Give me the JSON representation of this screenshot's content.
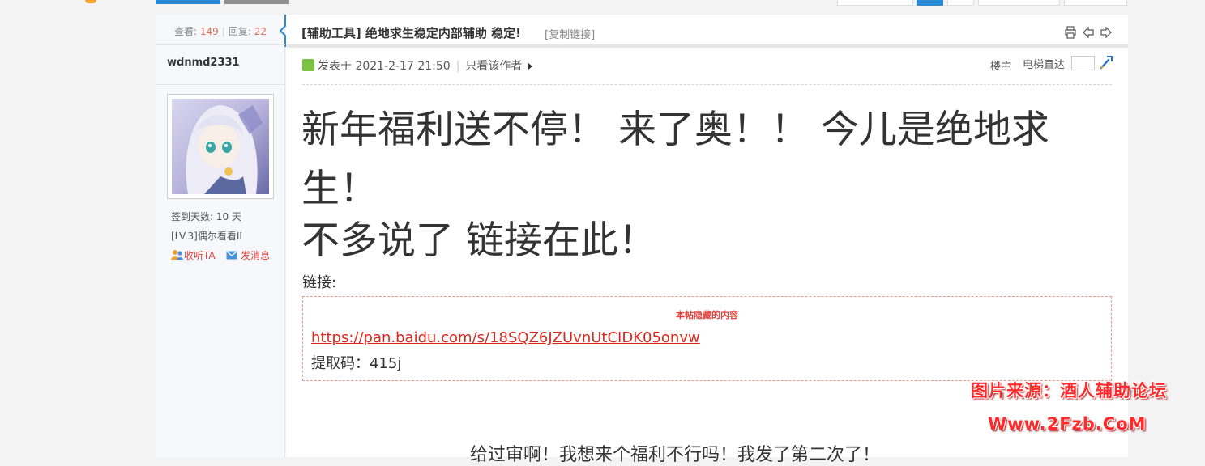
{
  "thread": {
    "title": "[辅助工具] 绝地求生稳定内部辅助 稳定!",
    "copy_link": "[复制链接]",
    "views_label": "查看:",
    "views": "149",
    "replies_label": "回复:",
    "replies": "22"
  },
  "author": {
    "username": "wdnmd2331",
    "signin": "签到天数: 10 天",
    "level": "[LV.3]偶尔看看II",
    "follow_label": "收听TA",
    "message_label": "发消息"
  },
  "post": {
    "posted_at": "发表于 2021-2-17 21:50",
    "only_author": "只看该作者",
    "floor_label": "楼主",
    "jump_label": "电梯直达",
    "headline_1": "新年福利送不停！ 来了奥！！ 今儿是绝地求生！",
    "headline_2": "不多说了 链接在此！",
    "link_label": "链接:",
    "hidden_title": "本帖隐藏的内容",
    "pan_url": "https://pan.baidu.com/s/18SQZ6JZUvnUtCIDK05onvw",
    "extract_code": "提取码：415j",
    "bottom_text": "给过审啊！我想来个福利不行吗！我发了第二次了！"
  },
  "watermark": {
    "line1": "图片来源：酒人辅助论坛",
    "line2": "Www.2Fzb.CoM"
  },
  "colors": {
    "accent_blue": "#2b8ad6",
    "link_red": "#d9261c",
    "number_red": "#e06a5a"
  },
  "icons": [
    "print-icon",
    "prev-thread-icon",
    "next-thread-icon",
    "jump-go-icon",
    "post-online-icon",
    "follow-icon",
    "message-icon"
  ]
}
